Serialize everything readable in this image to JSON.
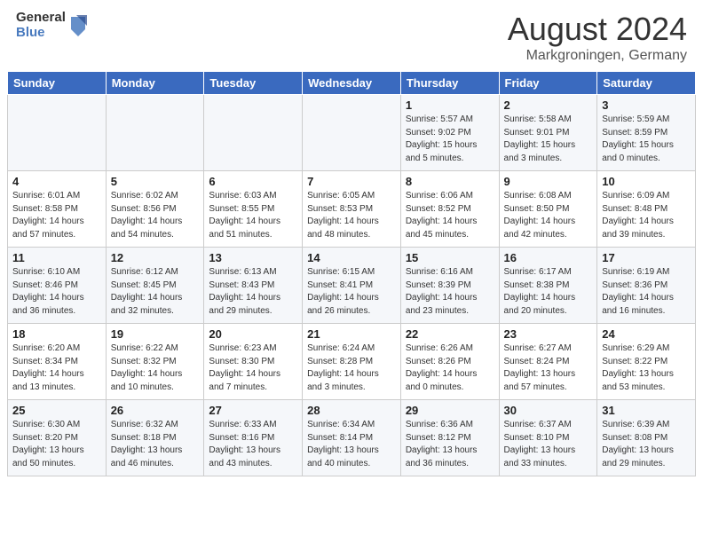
{
  "header": {
    "logo_general": "General",
    "logo_blue": "Blue",
    "month_year": "August 2024",
    "location": "Markgroningen, Germany"
  },
  "weekdays": [
    "Sunday",
    "Monday",
    "Tuesday",
    "Wednesday",
    "Thursday",
    "Friday",
    "Saturday"
  ],
  "weeks": [
    [
      {
        "day": "",
        "info": ""
      },
      {
        "day": "",
        "info": ""
      },
      {
        "day": "",
        "info": ""
      },
      {
        "day": "",
        "info": ""
      },
      {
        "day": "1",
        "info": "Sunrise: 5:57 AM\nSunset: 9:02 PM\nDaylight: 15 hours\nand 5 minutes."
      },
      {
        "day": "2",
        "info": "Sunrise: 5:58 AM\nSunset: 9:01 PM\nDaylight: 15 hours\nand 3 minutes."
      },
      {
        "day": "3",
        "info": "Sunrise: 5:59 AM\nSunset: 8:59 PM\nDaylight: 15 hours\nand 0 minutes."
      }
    ],
    [
      {
        "day": "4",
        "info": "Sunrise: 6:01 AM\nSunset: 8:58 PM\nDaylight: 14 hours\nand 57 minutes."
      },
      {
        "day": "5",
        "info": "Sunrise: 6:02 AM\nSunset: 8:56 PM\nDaylight: 14 hours\nand 54 minutes."
      },
      {
        "day": "6",
        "info": "Sunrise: 6:03 AM\nSunset: 8:55 PM\nDaylight: 14 hours\nand 51 minutes."
      },
      {
        "day": "7",
        "info": "Sunrise: 6:05 AM\nSunset: 8:53 PM\nDaylight: 14 hours\nand 48 minutes."
      },
      {
        "day": "8",
        "info": "Sunrise: 6:06 AM\nSunset: 8:52 PM\nDaylight: 14 hours\nand 45 minutes."
      },
      {
        "day": "9",
        "info": "Sunrise: 6:08 AM\nSunset: 8:50 PM\nDaylight: 14 hours\nand 42 minutes."
      },
      {
        "day": "10",
        "info": "Sunrise: 6:09 AM\nSunset: 8:48 PM\nDaylight: 14 hours\nand 39 minutes."
      }
    ],
    [
      {
        "day": "11",
        "info": "Sunrise: 6:10 AM\nSunset: 8:46 PM\nDaylight: 14 hours\nand 36 minutes."
      },
      {
        "day": "12",
        "info": "Sunrise: 6:12 AM\nSunset: 8:45 PM\nDaylight: 14 hours\nand 32 minutes."
      },
      {
        "day": "13",
        "info": "Sunrise: 6:13 AM\nSunset: 8:43 PM\nDaylight: 14 hours\nand 29 minutes."
      },
      {
        "day": "14",
        "info": "Sunrise: 6:15 AM\nSunset: 8:41 PM\nDaylight: 14 hours\nand 26 minutes."
      },
      {
        "day": "15",
        "info": "Sunrise: 6:16 AM\nSunset: 8:39 PM\nDaylight: 14 hours\nand 23 minutes."
      },
      {
        "day": "16",
        "info": "Sunrise: 6:17 AM\nSunset: 8:38 PM\nDaylight: 14 hours\nand 20 minutes."
      },
      {
        "day": "17",
        "info": "Sunrise: 6:19 AM\nSunset: 8:36 PM\nDaylight: 14 hours\nand 16 minutes."
      }
    ],
    [
      {
        "day": "18",
        "info": "Sunrise: 6:20 AM\nSunset: 8:34 PM\nDaylight: 14 hours\nand 13 minutes."
      },
      {
        "day": "19",
        "info": "Sunrise: 6:22 AM\nSunset: 8:32 PM\nDaylight: 14 hours\nand 10 minutes."
      },
      {
        "day": "20",
        "info": "Sunrise: 6:23 AM\nSunset: 8:30 PM\nDaylight: 14 hours\nand 7 minutes."
      },
      {
        "day": "21",
        "info": "Sunrise: 6:24 AM\nSunset: 8:28 PM\nDaylight: 14 hours\nand 3 minutes."
      },
      {
        "day": "22",
        "info": "Sunrise: 6:26 AM\nSunset: 8:26 PM\nDaylight: 14 hours\nand 0 minutes."
      },
      {
        "day": "23",
        "info": "Sunrise: 6:27 AM\nSunset: 8:24 PM\nDaylight: 13 hours\nand 57 minutes."
      },
      {
        "day": "24",
        "info": "Sunrise: 6:29 AM\nSunset: 8:22 PM\nDaylight: 13 hours\nand 53 minutes."
      }
    ],
    [
      {
        "day": "25",
        "info": "Sunrise: 6:30 AM\nSunset: 8:20 PM\nDaylight: 13 hours\nand 50 minutes."
      },
      {
        "day": "26",
        "info": "Sunrise: 6:32 AM\nSunset: 8:18 PM\nDaylight: 13 hours\nand 46 minutes."
      },
      {
        "day": "27",
        "info": "Sunrise: 6:33 AM\nSunset: 8:16 PM\nDaylight: 13 hours\nand 43 minutes."
      },
      {
        "day": "28",
        "info": "Sunrise: 6:34 AM\nSunset: 8:14 PM\nDaylight: 13 hours\nand 40 minutes."
      },
      {
        "day": "29",
        "info": "Sunrise: 6:36 AM\nSunset: 8:12 PM\nDaylight: 13 hours\nand 36 minutes."
      },
      {
        "day": "30",
        "info": "Sunrise: 6:37 AM\nSunset: 8:10 PM\nDaylight: 13 hours\nand 33 minutes."
      },
      {
        "day": "31",
        "info": "Sunrise: 6:39 AM\nSunset: 8:08 PM\nDaylight: 13 hours\nand 29 minutes."
      }
    ]
  ]
}
